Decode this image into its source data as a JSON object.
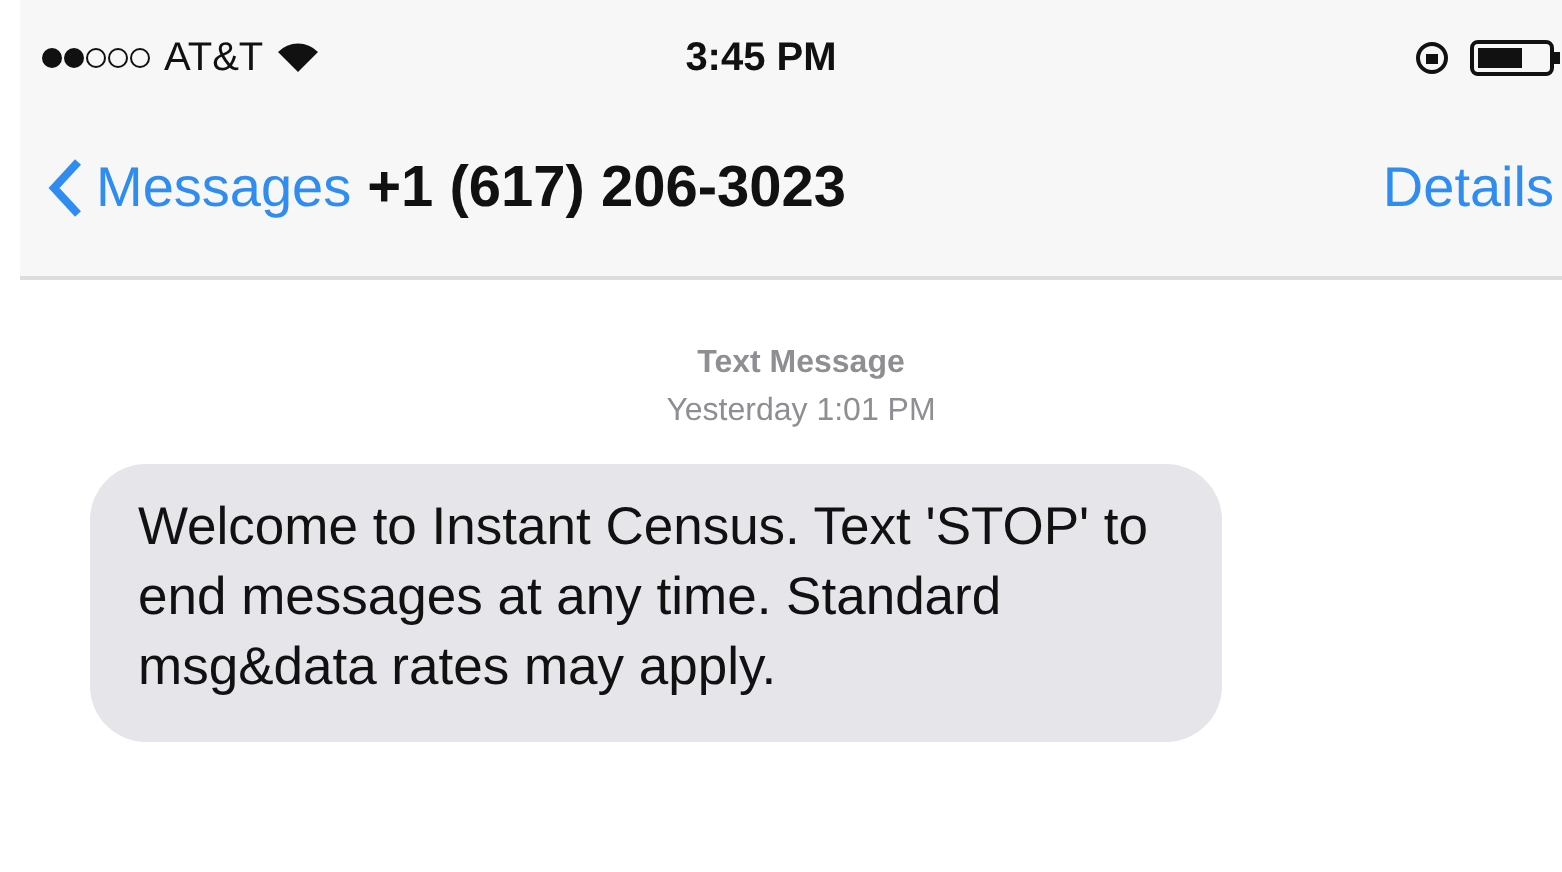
{
  "status_bar": {
    "carrier": "AT&T",
    "time": "3:45 PM"
  },
  "nav": {
    "back": "Messages",
    "title": "+1 (617) 206-3023",
    "action": "Details"
  },
  "conversation": {
    "label": "Text Message",
    "timestamp": "Yesterday 1:01 PM",
    "messages": [
      {
        "text": "Welcome to Instant Census. Text 'STOP' to end messages at any time. Standard msg&data rates may apply.",
        "incoming": true
      }
    ]
  }
}
